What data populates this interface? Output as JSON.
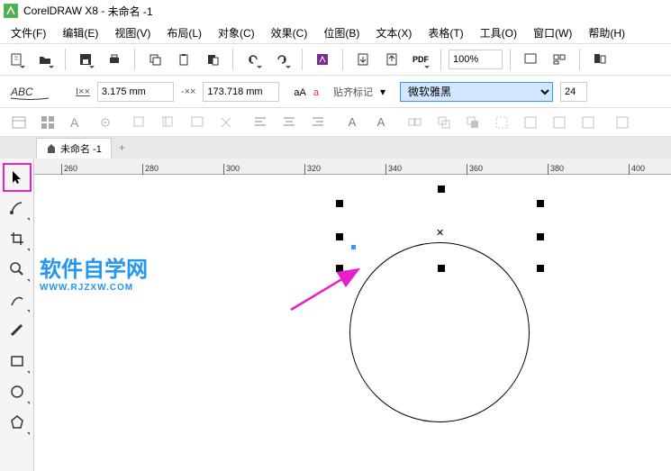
{
  "titlebar": {
    "app": "CorelDRAW X8",
    "doc": "未命名 -1"
  },
  "menu": {
    "file": "文件(F)",
    "edit": "编辑(E)",
    "view": "视图(V)",
    "layout": "布局(L)",
    "object": "对象(C)",
    "effect": "效果(C)",
    "bitmap": "位图(B)",
    "text": "文本(X)",
    "table": "表格(T)",
    "tool": "工具(O)",
    "window": "窗口(W)",
    "help": "帮助(H)"
  },
  "toolbar": {
    "zoom": "100%"
  },
  "propbar": {
    "kerning": "3.175 mm",
    "width": "173.718 mm",
    "align_label": "贴齐标记",
    "font": "微软雅黑",
    "fontsize": "24"
  },
  "tab": {
    "name": "未命名 -1",
    "add": "+"
  },
  "ruler_ticks": [
    "260",
    "280",
    "300",
    "320",
    "340",
    "360",
    "380",
    "400"
  ],
  "canvas": {
    "watermark_text": "软件自学网",
    "watermark_url": "WWW.RJZXW.COM",
    "path_text": "软件自学网"
  }
}
